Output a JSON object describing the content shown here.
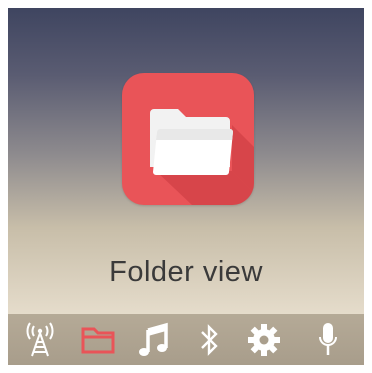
{
  "app": {
    "label": "Folder view",
    "icon": "folder-icon",
    "tile_color": "#e95458"
  },
  "dock": {
    "items": [
      {
        "icon": "antenna-icon",
        "active": false
      },
      {
        "icon": "folder-icon",
        "active": true
      },
      {
        "icon": "music-note-icon",
        "active": false
      },
      {
        "icon": "bluetooth-icon",
        "active": false
      },
      {
        "icon": "gear-icon",
        "active": false
      },
      {
        "icon": "microphone-icon",
        "active": false
      }
    ],
    "active_color": "#e95458",
    "inactive_color": "#ffffff"
  }
}
